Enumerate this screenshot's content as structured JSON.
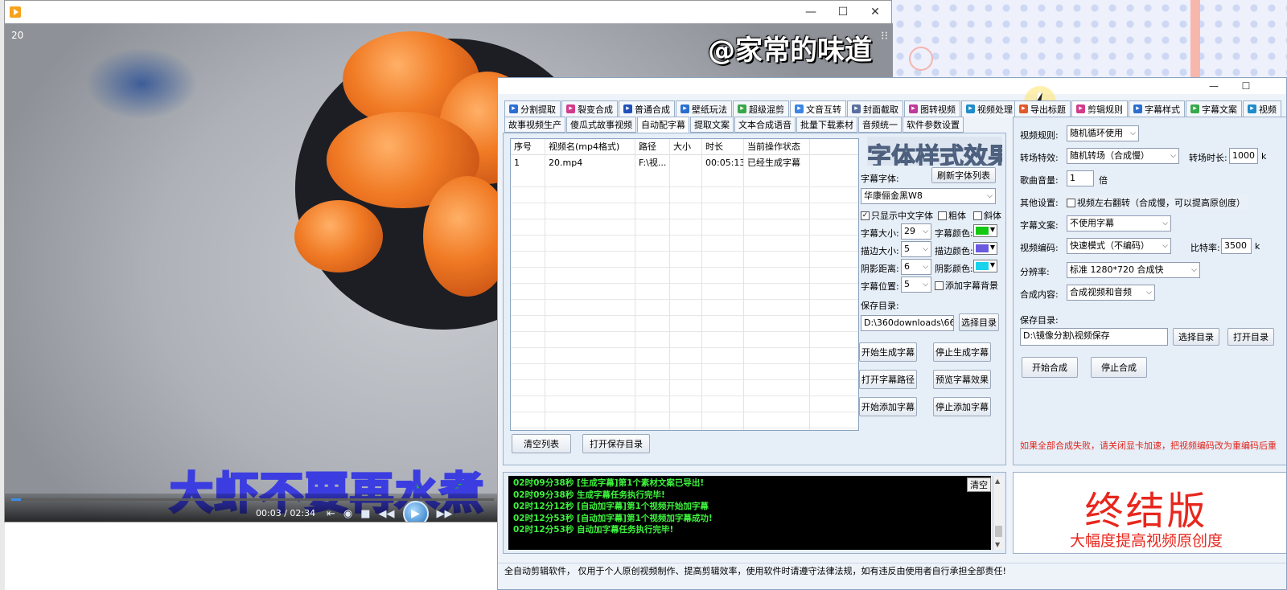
{
  "player": {
    "counter": "20",
    "watermark": "@家常的味道",
    "subtitle": "大虾不要再水煮",
    "time": "00:03 / 02:34",
    "progress_fraction": 0.02,
    "controls": [
      "previous-icon",
      "stop-icon",
      "rewind-icon",
      "play-icon",
      "fast-forward-icon"
    ]
  },
  "tool": {
    "tabs_main": [
      {
        "label": "分割提取",
        "icon_color": "#2b6fd6"
      },
      {
        "label": "裂变合成",
        "icon_color": "#d23a8a"
      },
      {
        "label": "普通合成",
        "icon_color": "#1e50b8"
      },
      {
        "label": "壁纸玩法",
        "icon_color": "#2a6fd0"
      },
      {
        "label": "超级混剪",
        "icon_color": "#38a84a"
      },
      {
        "label": "文音互转",
        "icon_color": "#3b86e3"
      },
      {
        "label": "封面截取",
        "icon_color": "#5a6fa0"
      },
      {
        "label": "图转视频",
        "icon_color": "#c0389a"
      },
      {
        "label": "视频处理",
        "icon_color": "#1f8cc8"
      }
    ],
    "tabs_sub": [
      "故事视频生产",
      "傻瓜式故事视频",
      "自动配字幕",
      "提取文案",
      "文本合成语音",
      "批量下载素材",
      "音频统一",
      "软件参数设置"
    ],
    "table": {
      "headers": [
        "序号",
        "视频名(mp4格式)",
        "路径",
        "大小",
        "时长",
        "当前操作状态"
      ],
      "rows": [
        [
          "1",
          "20.mp4",
          "F:\\视...",
          "",
          "00:05:13",
          "已经生成字幕"
        ]
      ]
    },
    "clear_list": "清空列表",
    "open_save_dir": "打开保存目录",
    "font_preview": "字体样式效果",
    "subtitle_font_label": "字幕字体:",
    "refresh_fonts": "刷新字体列表",
    "font_value": "华康俪金黑W8",
    "only_chinese": "只显示中文字体",
    "bold": "粗体",
    "italic": "斜体",
    "font_size_label": "字幕大小:",
    "font_size": "29",
    "font_color_label": "字幕颜色:",
    "font_color": "#14c814",
    "stroke_size_label": "描边大小:",
    "stroke_size": "5",
    "stroke_color_label": "描边颜色:",
    "stroke_color": "#6a5ae0",
    "shadow_dist_label": "阴影距离:",
    "shadow_dist": "6",
    "shadow_color_label": "阴影颜色:",
    "shadow_color": "#19d2ec",
    "position_label": "字幕位置:",
    "position": "5",
    "add_bg": "添加字幕背景",
    "save_dir_label": "保存目录:",
    "save_dir": "D:\\360downloads\\66",
    "choose_dir": "选择目录",
    "start_gen": "开始生成字幕",
    "stop_gen": "停止生成字幕",
    "open_sub_path": "打开字幕路径",
    "preview_effect": "预览字幕效果",
    "start_add": "开始添加字幕",
    "stop_add": "停止添加字幕",
    "log_lines": [
      "02时09分38秒 [生成字幕]第1个素材文案已导出!",
      "02时09分38秒 生成字幕任务执行完毕!",
      "02时12分12秒 [自动加字幕]第1个视频开始加字幕",
      "02时12分53秒 [自动加字幕]第1个视频加字幕成功!",
      "02时12分53秒 自动加字幕任务执行完毕!"
    ],
    "log_clear": "清空",
    "right_tabs": [
      {
        "label": "导出标题",
        "icon_color": "#e05a2a"
      },
      {
        "label": "剪辑规则",
        "icon_color": "#d23a8a"
      },
      {
        "label": "字幕样式",
        "icon_color": "#2a6fd0"
      },
      {
        "label": "字幕文案",
        "icon_color": "#38a84a"
      },
      {
        "label": "视频",
        "icon_color": "#1f8cc8"
      }
    ],
    "right": {
      "rule_label": "视频规则:",
      "rule_value": "随机循环使用",
      "transition_label": "转场特效:",
      "transition_value": "随机转场（合成慢）",
      "transition_time_label": "转场时长:",
      "transition_time": "1000",
      "transition_time_unit": "k",
      "volume_label": "歌曲音量:",
      "volume": "1",
      "volume_unit": "倍",
      "other_label": "其他设置:",
      "flip_label": "视频左右翻转（合成慢，可以提高原创度）",
      "subtitle_text_label": "字幕文案:",
      "subtitle_text_value": "不使用字幕",
      "encode_label": "视频编码:",
      "encode_value": "快速模式（不编码）",
      "bitrate_label": "比特率:",
      "bitrate": "3500",
      "bitrate_unit": "k",
      "resolution_label": "分辨率:",
      "resolution_value": "标准 1280*720 合成快",
      "content_label": "合成内容:",
      "content_value": "合成视频和音频",
      "save_dir_label": "保存目录:",
      "save_dir": "D:\\镜像分割\\视频保存",
      "choose_dir": "选择目录",
      "open_dir": "打开目录",
      "start_compose": "开始合成",
      "stop_compose": "停止合成",
      "warning": "如果全部合成失败，请关闭显卡加速，把视频编码改为重编码后重"
    },
    "promo_title": "终结版",
    "promo_sub": "大幅度提高视频原创度",
    "status": "全自动剪辑软件， 仅用于个人原创视频制作、提高剪辑效率，使用软件时请遵守法律法规，如有违反由使用者自行承担全部责任!"
  }
}
